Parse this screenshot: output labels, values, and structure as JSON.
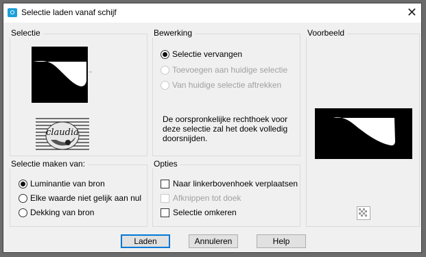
{
  "window": {
    "title": "Selectie laden vanaf schijf",
    "close_glyph": "✕"
  },
  "selectie": {
    "label": "Selectie",
    "watermark_text": "claudia"
  },
  "bewerking": {
    "label": "Bewerking",
    "options": [
      {
        "label": "Selectie vervangen",
        "selected": true,
        "enabled": true
      },
      {
        "label": "Toevoegen aan huidige selectie",
        "selected": false,
        "enabled": false
      },
      {
        "label": "Van huidige selectie aftrekken",
        "selected": false,
        "enabled": false
      }
    ],
    "description_lines": [
      "De oorspronkelijke rechthoek voor",
      "deze selectie zal het doek volledig",
      "doorsnijden."
    ]
  },
  "voorbeeld": {
    "label": "Voorbeeld"
  },
  "maken_van": {
    "label": "Selectie maken van:",
    "options": [
      {
        "label": "Luminantie van bron",
        "selected": true
      },
      {
        "label": "Elke waarde niet gelijk aan nul",
        "selected": false
      },
      {
        "label": "Dekking van bron",
        "selected": false
      }
    ]
  },
  "opties": {
    "label": "Opties",
    "checkboxes": [
      {
        "label": "Naar linkerbovenhoek verplaatsen",
        "checked": false,
        "enabled": true
      },
      {
        "label": "Afknippen tot doek",
        "checked": false,
        "enabled": false
      },
      {
        "label": "Selectie omkeren",
        "checked": false,
        "enabled": true
      }
    ]
  },
  "buttons": {
    "laden": "Laden",
    "annuleren": "Annuleren",
    "help": "Help"
  },
  "icons": {
    "app": "selection-app-icon",
    "close": "close-icon",
    "zoom": "checker-zoom-icon"
  },
  "colors": {
    "accent": "#0078d7",
    "disabled_text": "#a0a0a0"
  }
}
